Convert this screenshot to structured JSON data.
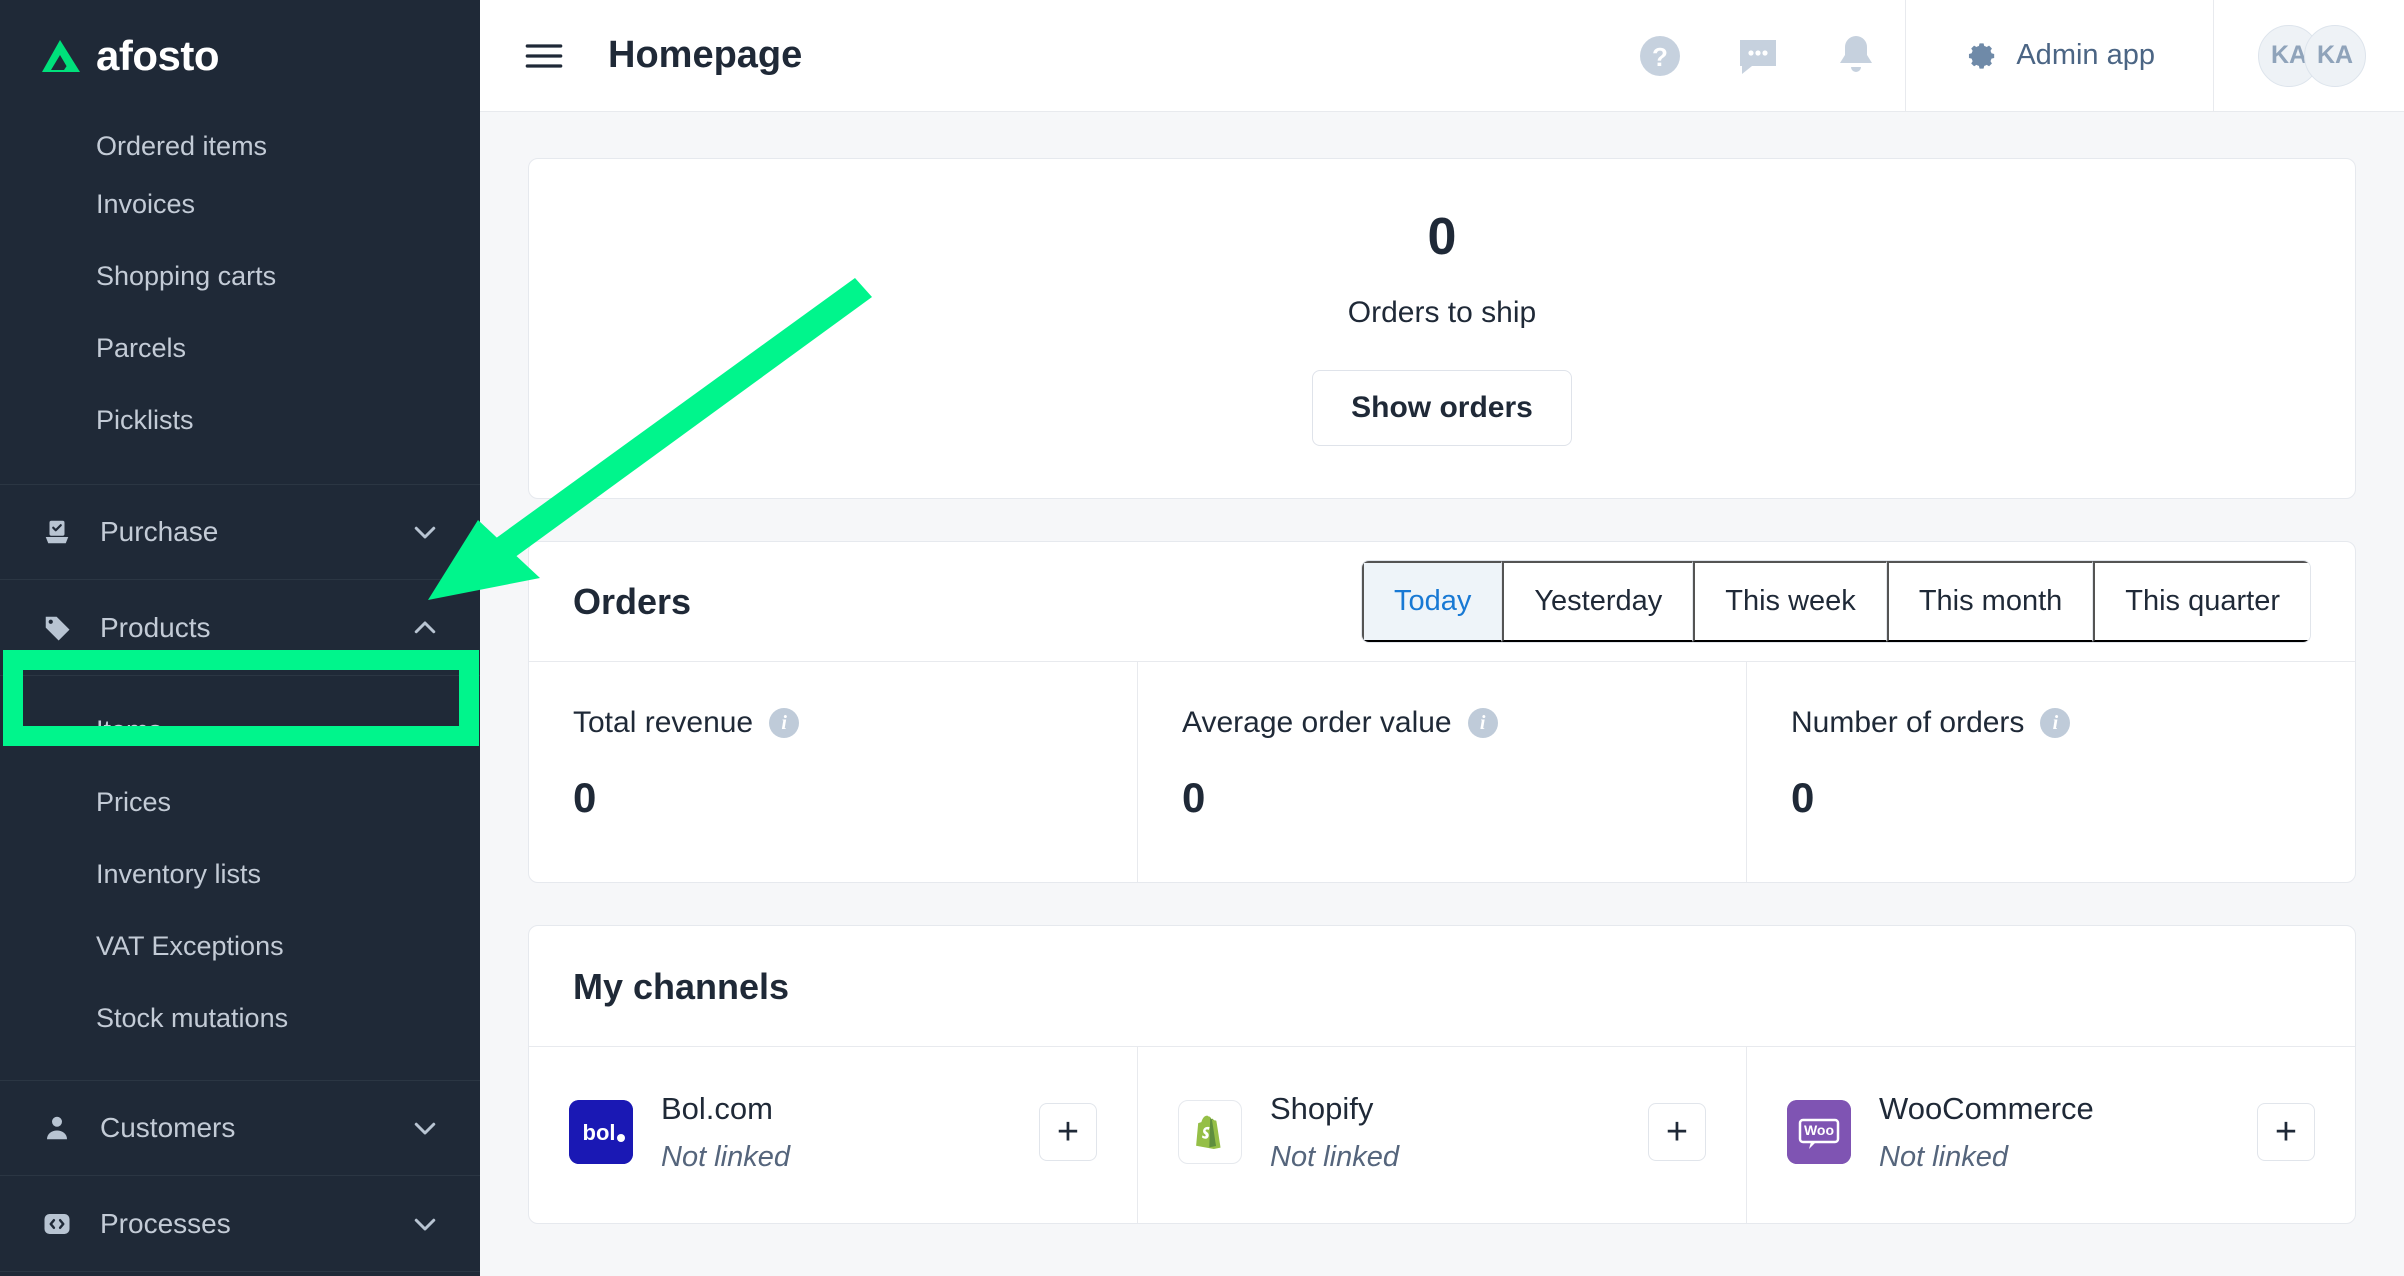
{
  "brand": {
    "name": "afosto",
    "accent": "#00e07b",
    "logo_icon": "afosto-triangle-logo"
  },
  "sidebar": {
    "sub_top": [
      {
        "label": "Ordered items",
        "clipped": true
      },
      {
        "label": "Invoices"
      },
      {
        "label": "Shopping carts"
      },
      {
        "label": "Parcels"
      },
      {
        "label": "Picklists"
      }
    ],
    "groups": [
      {
        "label": "Purchase",
        "icon": "inbox-check-icon",
        "chevron": "chevron-down-icon",
        "expanded": false,
        "children": []
      },
      {
        "label": "Products",
        "icon": "tag-icon",
        "chevron": "chevron-up-icon",
        "expanded": true,
        "children": [
          {
            "label": "Items",
            "highlighted": true
          },
          {
            "label": "Prices"
          },
          {
            "label": "Inventory lists"
          },
          {
            "label": "VAT Exceptions"
          },
          {
            "label": "Stock mutations"
          }
        ]
      },
      {
        "label": "Customers",
        "icon": "user-icon",
        "chevron": "chevron-down-icon",
        "expanded": false,
        "children": []
      },
      {
        "label": "Processes",
        "icon": "code-brackets-icon",
        "chevron": "chevron-down-icon",
        "expanded": false,
        "children": []
      }
    ]
  },
  "topbar": {
    "menu_icon": "hamburger-menu-icon",
    "title": "Homepage",
    "icons": [
      {
        "name": "help-icon",
        "glyph": "?"
      },
      {
        "name": "chat-icon",
        "glyph": "chat-bubble"
      },
      {
        "name": "notifications-bell-icon",
        "glyph": "bell"
      }
    ],
    "admin_app_label": "Admin app",
    "admin_app_icon": "gear-icon",
    "avatars": [
      {
        "initials": "KA"
      },
      {
        "initials": "KA"
      }
    ]
  },
  "ship_card": {
    "count": "0",
    "label": "Orders to ship",
    "button_label": "Show orders"
  },
  "orders": {
    "title": "Orders",
    "periods": [
      {
        "label": "Today",
        "active": true
      },
      {
        "label": "Yesterday",
        "active": false
      },
      {
        "label": "This week",
        "active": false
      },
      {
        "label": "This month",
        "active": false
      },
      {
        "label": "This quarter",
        "active": false
      }
    ],
    "metrics": [
      {
        "label": "Total revenue",
        "value": "0",
        "info_icon": "info-icon"
      },
      {
        "label": "Average order value",
        "value": "0",
        "info_icon": "info-icon"
      },
      {
        "label": "Number of orders",
        "value": "0",
        "info_icon": "info-icon"
      }
    ]
  },
  "channels": {
    "title": "My channels",
    "items": [
      {
        "name": "Bol.com",
        "status": "Not linked",
        "logo": "bol-logo",
        "logo_bg": "#1a18b4",
        "add_label": "+"
      },
      {
        "name": "Shopify",
        "status": "Not linked",
        "logo": "shopify-logo",
        "logo_bg": "#ffffff",
        "add_label": "+"
      },
      {
        "name": "WooCommerce",
        "status": "Not linked",
        "logo": "woocommerce-logo",
        "logo_bg": "#7f54b3",
        "add_label": "+"
      }
    ]
  },
  "annotation": {
    "arrow_color": "#00F58C",
    "highlight_color": "#00F58C",
    "arrow_points_to": "Items",
    "highlight_target": "Items"
  }
}
